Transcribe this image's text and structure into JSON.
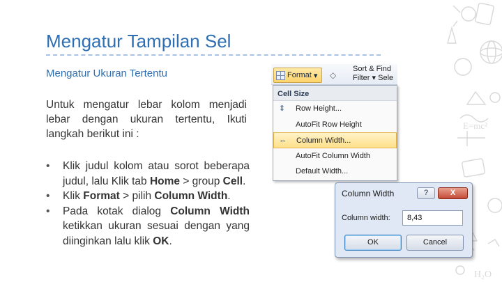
{
  "slide": {
    "title": "Mengatur Tampilan Sel",
    "subtitle": "Mengatur Ukuran Tertentu",
    "intro": "Untuk mengatur lebar kolom menjadi lebar dengan ukuran tertentu, Ikuti langkah berikut ini :",
    "bullet_marker": "•"
  },
  "steps": [
    {
      "parts": [
        "Klik judul kolom atau sorot beberapa judul, lalu Klik tab ",
        "Home",
        " > group ",
        "Cell",
        "."
      ]
    },
    {
      "parts": [
        "Klik ",
        "Format",
        " > pilih ",
        "Column Width",
        "."
      ]
    },
    {
      "parts": [
        "Pada kotak dialog ",
        "Column Width",
        " ketikkan ukuran sesuai dengan yang diinginkan lalu klik ",
        "OK",
        "."
      ]
    }
  ],
  "ribbon": {
    "format_label": "Format",
    "format_arrow": "▾",
    "sort_label": "Sort &",
    "find_label": "Find",
    "filter_label": "Filter",
    "filter_arrow": "▾",
    "select_label": "Sele"
  },
  "menu": {
    "header": "Cell Size",
    "items": [
      {
        "label": "Row Height...",
        "icon": "row-height-icon"
      },
      {
        "label": "AutoFit Row Height",
        "icon": ""
      },
      {
        "label": "Column Width...",
        "icon": "column-width-icon",
        "highlighted": true
      },
      {
        "label": "AutoFit Column Width",
        "icon": ""
      },
      {
        "label": "Default Width...",
        "icon": ""
      }
    ]
  },
  "dialog": {
    "title": "Column Width",
    "help_label": "?",
    "close_label": "X",
    "field_label": "Column width:",
    "field_value": "8,43",
    "ok_label": "OK",
    "cancel_label": "Cancel"
  }
}
